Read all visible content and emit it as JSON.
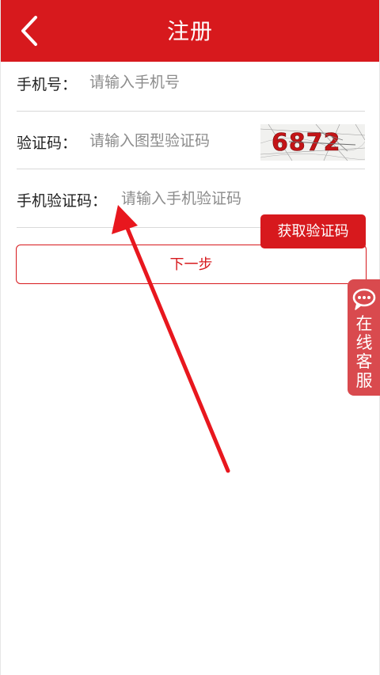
{
  "header": {
    "title": "注册",
    "back_icon": "chevron-left-icon",
    "background_color": "#d7191d"
  },
  "form": {
    "phone": {
      "label": "手机号：",
      "placeholder": "请输入手机号",
      "value": ""
    },
    "captcha": {
      "label": "验证码：",
      "placeholder": "请输入图型验证码",
      "value": "",
      "image_text": "6872"
    },
    "sms_code": {
      "label": "手机验证码：",
      "placeholder": "请输入手机验证码",
      "value": "",
      "button_label": "获取验证码"
    },
    "next_label": "下一步"
  },
  "service": {
    "icon": "chat-bubble-icon",
    "chars": [
      "在",
      "线",
      "客",
      "服"
    ]
  },
  "colors": {
    "accent": "#d7191d",
    "service_tab": "#d94a4e",
    "annotation_arrow": "#e8171e"
  }
}
